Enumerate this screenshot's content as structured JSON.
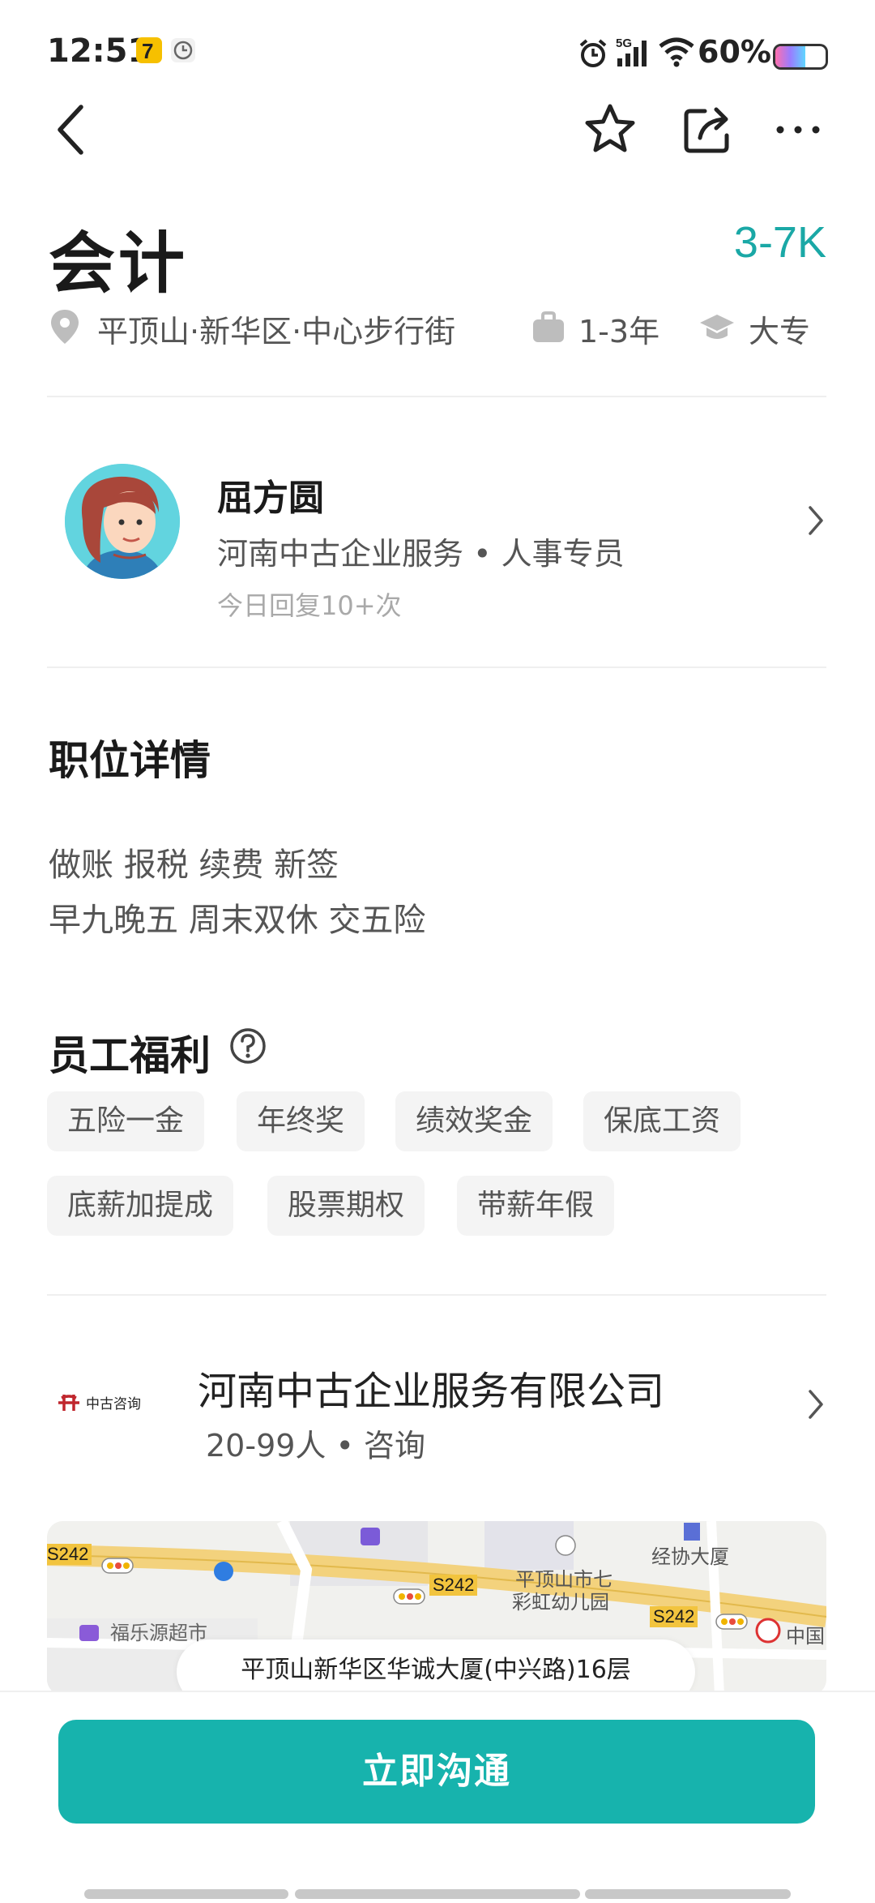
{
  "status_bar": {
    "time": "12:51",
    "network": "5G",
    "battery": "60%",
    "battery_level": 0.6
  },
  "nav": {
    "back_icon": "chevron-left-icon",
    "favorite_icon": "star-icon",
    "share_icon": "share-icon",
    "more_icon": "more-icon"
  },
  "job": {
    "title": "会计",
    "salary": "3-7K",
    "location": "平顶山·新华区·中心步行街",
    "experience": "1-3年",
    "education": "大专"
  },
  "recruiter": {
    "name": "屈方圆",
    "company_role": "河南中古企业服务 • 人事专员",
    "reply_stat": "今日回复10+次"
  },
  "details": {
    "section_title": "职位详情",
    "lines": [
      "做账 报税 续费 新签",
      "早九晚五 周末双休 交五险"
    ]
  },
  "benefits": {
    "section_title": "员工福利",
    "tags": [
      "五险一金",
      "年终奖",
      "绩效奖金",
      "保底工资",
      "底薪加提成",
      "股票期权",
      "带薪年假"
    ]
  },
  "company": {
    "logo_text": "中古咨询",
    "name": "河南中古企业服务有限公司",
    "meta": "20-99人 • 咨询"
  },
  "map": {
    "labels": [
      "S242",
      "S242",
      "S242",
      "经协大厦",
      "平顶山市七",
      "彩虹幼儿园",
      "福乐源超市",
      "中国"
    ],
    "address": "平顶山新华区华诚大厦(中兴路)16层"
  },
  "cta": {
    "label": "立即沟通"
  },
  "colors": {
    "accent": "#1aa8a6",
    "button": "#17b3ad"
  }
}
